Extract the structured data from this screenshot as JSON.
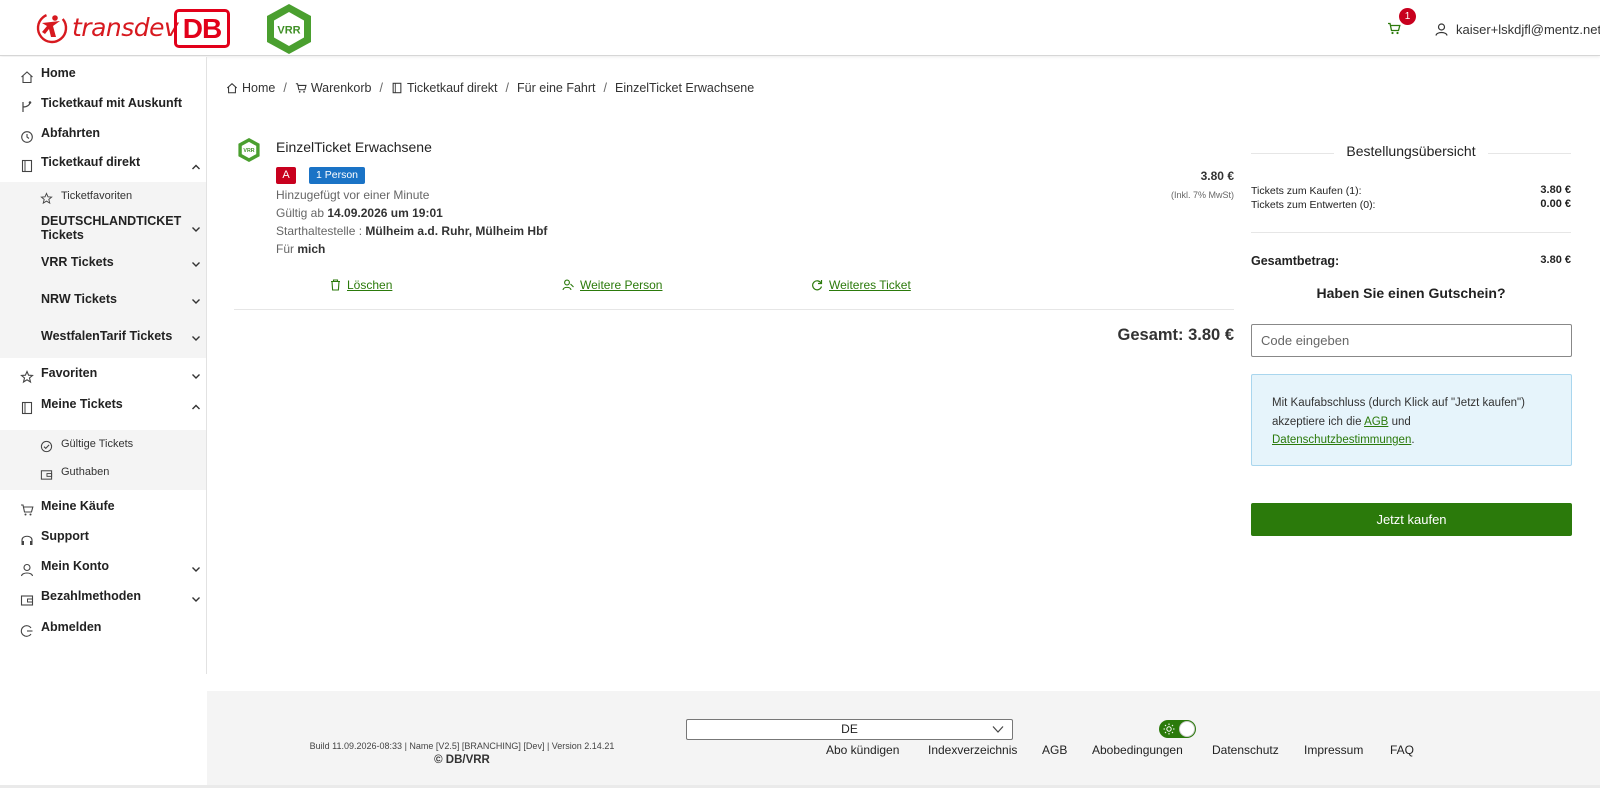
{
  "header": {
    "brand_transdev": "transdev",
    "brand_db": "DB",
    "brand_vrr": "VRR",
    "cart_count": "1",
    "user_email": "kaiser+lskdjfl@mentz.net"
  },
  "sidebar": {
    "home": "Home",
    "ticketkauf_auskunft": "Ticketkauf mit Auskunft",
    "abfahrten": "Abfahrten",
    "ticketkauf_direkt": "Ticketkauf direkt",
    "ticketfavoriten": "Ticketfavoriten",
    "deutschlandticket": "DEUTSCHLANDTICKET Tickets",
    "vrr_tickets": "VRR Tickets",
    "nrw_tickets": "NRW Tickets",
    "westfalentarif": "WestfalenTarif Tickets",
    "favoriten": "Favoriten",
    "meine_tickets": "Meine Tickets",
    "gueltige_tickets": "Gültige Tickets",
    "guthaben": "Guthaben",
    "meine_kaeufe": "Meine Käufe",
    "support": "Support",
    "mein_konto": "Mein Konto",
    "bezahlmethoden": "Bezahlmethoden",
    "abmelden": "Abmelden"
  },
  "breadcrumb": {
    "home": "Home",
    "warenkorb": "Warenkorb",
    "ticketkauf_direkt": "Ticketkauf direkt",
    "fuer_eine_fahrt": "Für eine Fahrt",
    "current": "EinzelTicket Erwachsene"
  },
  "ticket": {
    "title": "EinzelTicket Erwachsene",
    "zone": "A",
    "persons": "1 Person",
    "price": "3.80 €",
    "vat": "(Inkl. 7% MwSt)",
    "added": "Hinzugefügt vor einer Minute",
    "valid_label": "Gültig ab",
    "valid_value": "14.09.2026 um 19:01",
    "start_label": "Starthaltestelle :",
    "start_value": "Mülheim a.d. Ruhr, Mülheim Hbf",
    "for_label": "Für",
    "for_value": "mich",
    "delete": "Löschen",
    "add_person": "Weitere Person",
    "add_ticket": "Weiteres Ticket",
    "total": "Gesamt: 3.80 €"
  },
  "summary": {
    "title": "Bestellungsübersicht",
    "buy_label": "Tickets zum Kaufen (1):",
    "buy_value": "3.80 €",
    "void_label": "Tickets zum Entwerten (0):",
    "void_value": "0.00 €",
    "grand_label": "Gesamtbetrag:",
    "grand_value": "3.80 €",
    "voucher_title": "Haben Sie einen Gutschein?",
    "voucher_placeholder": "Code eingeben",
    "consent_pre": "Mit Kaufabschluss (durch Klick auf \"Jetzt kaufen\") akzeptiere ich die",
    "consent_agb": "AGB",
    "consent_and": "und",
    "consent_privacy": "Datenschutzbestimmungen",
    "consent_end": ".",
    "buy_button": "Jetzt kaufen"
  },
  "footer": {
    "build": "Build 11.09.2026-08:33 | Name [V2.5] [BRANCHING] [Dev] | Version 2.14.21",
    "copyright": "© DB/VRR",
    "language": "DE",
    "links": [
      "Abo kündigen",
      "Indexverzeichnis",
      "AGB",
      "Abobedingungen",
      "Datenschutz",
      "Impressum",
      "FAQ"
    ]
  },
  "colors": {
    "accent_green": "#2b7a0b",
    "brand_red": "#d7191f",
    "badge_blue": "#1a73c6",
    "vrr_green": "#4a9f2f"
  }
}
